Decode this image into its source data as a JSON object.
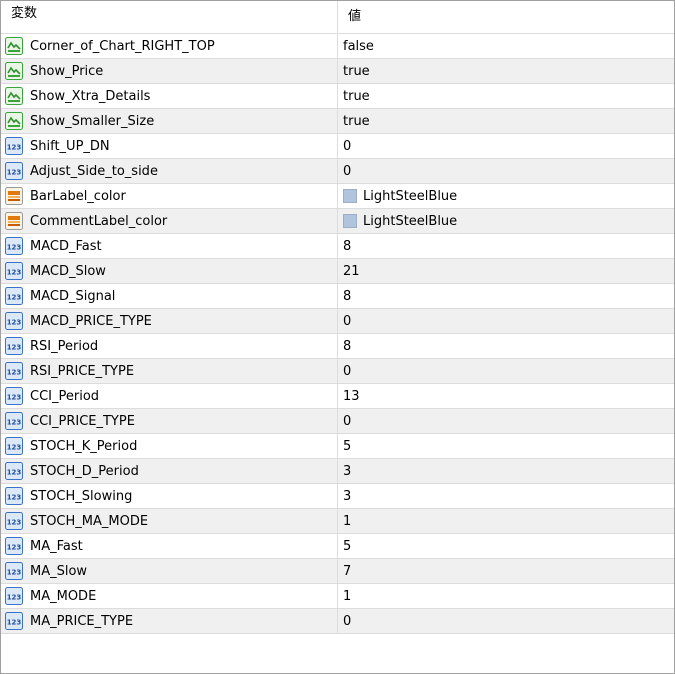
{
  "header": {
    "name_col": "変数",
    "value_col": "値"
  },
  "colors": {
    "bool_icon": "#3aa33a",
    "int_icon": "#3a72c4",
    "color_icon": "#e07a10",
    "swatch": "#b0c4de"
  },
  "rows": [
    {
      "type": "bool",
      "icon": "bool-icon",
      "name": "Corner_of_Chart_RIGHT_TOP",
      "value": "false"
    },
    {
      "type": "bool",
      "icon": "bool-icon",
      "name": "Show_Price",
      "value": "true"
    },
    {
      "type": "bool",
      "icon": "bool-icon",
      "name": "Show_Xtra_Details",
      "value": "true"
    },
    {
      "type": "bool",
      "icon": "bool-icon",
      "name": "Show_Smaller_Size",
      "value": "true"
    },
    {
      "type": "int",
      "icon": "int-icon",
      "name": "Shift_UP_DN",
      "value": "0"
    },
    {
      "type": "int",
      "icon": "int-icon",
      "name": "Adjust_Side_to_side",
      "value": "0"
    },
    {
      "type": "color",
      "icon": "color-icon",
      "name": "BarLabel_color",
      "value": "LightSteelBlue"
    },
    {
      "type": "color",
      "icon": "color-icon",
      "name": "CommentLabel_color",
      "value": "LightSteelBlue"
    },
    {
      "type": "int",
      "icon": "int-icon",
      "name": "MACD_Fast",
      "value": "8"
    },
    {
      "type": "int",
      "icon": "int-icon",
      "name": "MACD_Slow",
      "value": "21"
    },
    {
      "type": "int",
      "icon": "int-icon",
      "name": "MACD_Signal",
      "value": "8"
    },
    {
      "type": "int",
      "icon": "int-icon",
      "name": "MACD_PRICE_TYPE",
      "value": "0"
    },
    {
      "type": "int",
      "icon": "int-icon",
      "name": "RSI_Period",
      "value": "8"
    },
    {
      "type": "int",
      "icon": "int-icon",
      "name": "RSI_PRICE_TYPE",
      "value": "0"
    },
    {
      "type": "int",
      "icon": "int-icon",
      "name": "CCI_Period",
      "value": "13"
    },
    {
      "type": "int",
      "icon": "int-icon",
      "name": "CCI_PRICE_TYPE",
      "value": "0"
    },
    {
      "type": "int",
      "icon": "int-icon",
      "name": "STOCH_K_Period",
      "value": "5"
    },
    {
      "type": "int",
      "icon": "int-icon",
      "name": "STOCH_D_Period",
      "value": "3"
    },
    {
      "type": "int",
      "icon": "int-icon",
      "name": "STOCH_Slowing",
      "value": "3"
    },
    {
      "type": "int",
      "icon": "int-icon",
      "name": "STOCH_MA_MODE",
      "value": "1"
    },
    {
      "type": "int",
      "icon": "int-icon",
      "name": "MA_Fast",
      "value": "5"
    },
    {
      "type": "int",
      "icon": "int-icon",
      "name": "MA_Slow",
      "value": "7"
    },
    {
      "type": "int",
      "icon": "int-icon",
      "name": "MA_MODE",
      "value": "1"
    },
    {
      "type": "int",
      "icon": "int-icon",
      "name": "MA_PRICE_TYPE",
      "value": "0"
    }
  ]
}
